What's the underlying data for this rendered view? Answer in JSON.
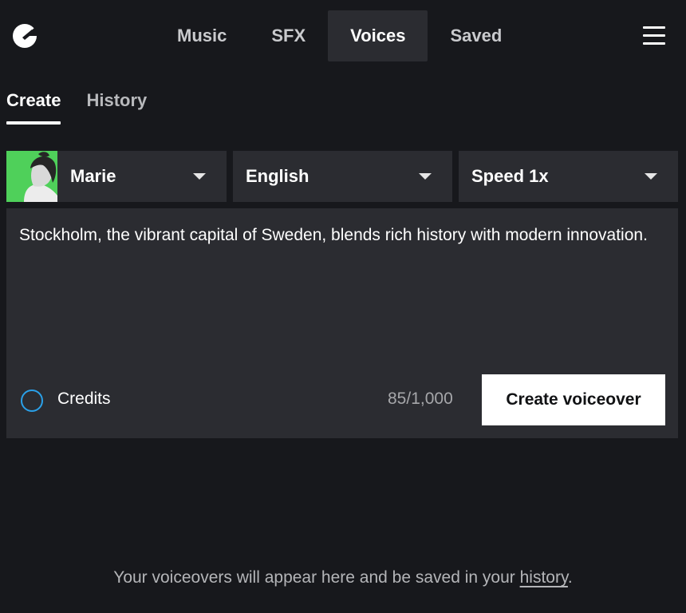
{
  "app": {
    "logo_icon": "brand-logo-icon",
    "menu_icon": "hamburger-menu-icon"
  },
  "main_nav": [
    {
      "label": "Music",
      "active": false
    },
    {
      "label": "SFX",
      "active": false
    },
    {
      "label": "Voices",
      "active": true
    },
    {
      "label": "Saved",
      "active": false
    }
  ],
  "sub_tabs": [
    {
      "label": "Create",
      "active": true
    },
    {
      "label": "History",
      "active": false
    }
  ],
  "selectors": {
    "voice": {
      "value": "Marie",
      "avatar_bg": "#4fd05a"
    },
    "language": {
      "value": "English"
    },
    "speed": {
      "value": "Speed 1x"
    }
  },
  "editor": {
    "text": "Stockholm, the vibrant capital of Sweden, blends rich history with modern innovation.",
    "credits_label": "Credits",
    "char_count": "85/1,000",
    "create_button_label": "Create voiceover"
  },
  "empty_state": {
    "text_before": "Your voiceovers will appear here and be saved in your ",
    "link_text": "history",
    "text_after": "."
  },
  "colors": {
    "background": "#17181c",
    "panel": "#2b2c31",
    "accent_ring": "#2aa0e8"
  }
}
